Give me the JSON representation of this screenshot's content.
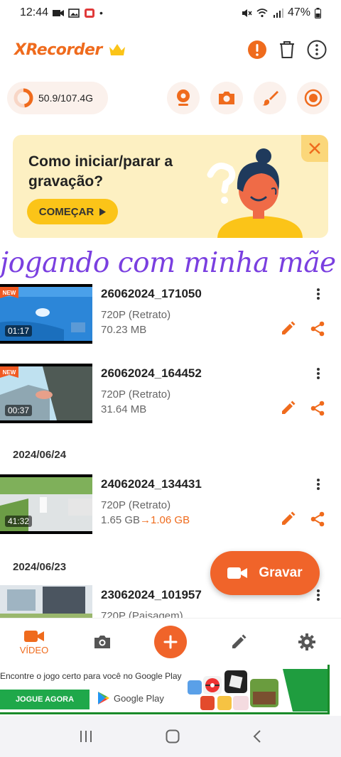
{
  "status_bar": {
    "time": "12:44",
    "battery": "47%"
  },
  "header": {
    "app_name": "XRecorder"
  },
  "toolbar": {
    "storage": "50.9/107.4G",
    "storage_used_fraction": 0.474
  },
  "banner": {
    "question": "Como iniciar/parar a gravação?",
    "button_label": "COMEÇAR"
  },
  "overlay": {
    "text": "jogando com minha mãe"
  },
  "videos": [
    {
      "name": "26062024_171050",
      "resolution": "720P (Retrato)",
      "size": "70.23 MB",
      "duration": "01:17",
      "badge": "NEW"
    },
    {
      "name": "26062024_164452",
      "resolution": "720P (Retrato)",
      "size": "31.64 MB",
      "duration": "00:37",
      "badge": "NEW"
    },
    {
      "name": "24062024_134431",
      "resolution": "720P (Retrato)",
      "size": "1.65 GB",
      "compressed_size": "1.06 GB",
      "duration": "41:32"
    },
    {
      "name": "23062024_101957",
      "resolution": "720P (Paisagem)"
    }
  ],
  "dates": [
    "2024/06/24",
    "2024/06/23"
  ],
  "fab": {
    "label": "Gravar"
  },
  "bottom_nav": {
    "video_label": "VÍDEO"
  },
  "ad": {
    "title": "Encontre o jogo certo para você no Google Play",
    "button": "JOGUE AGORA",
    "store": "Google Play"
  },
  "colors": {
    "accent": "#ef6b1d",
    "fab": "#f0642a",
    "banner_bg": "#fdf0c2",
    "overlay_text": "#7a3fe0"
  }
}
